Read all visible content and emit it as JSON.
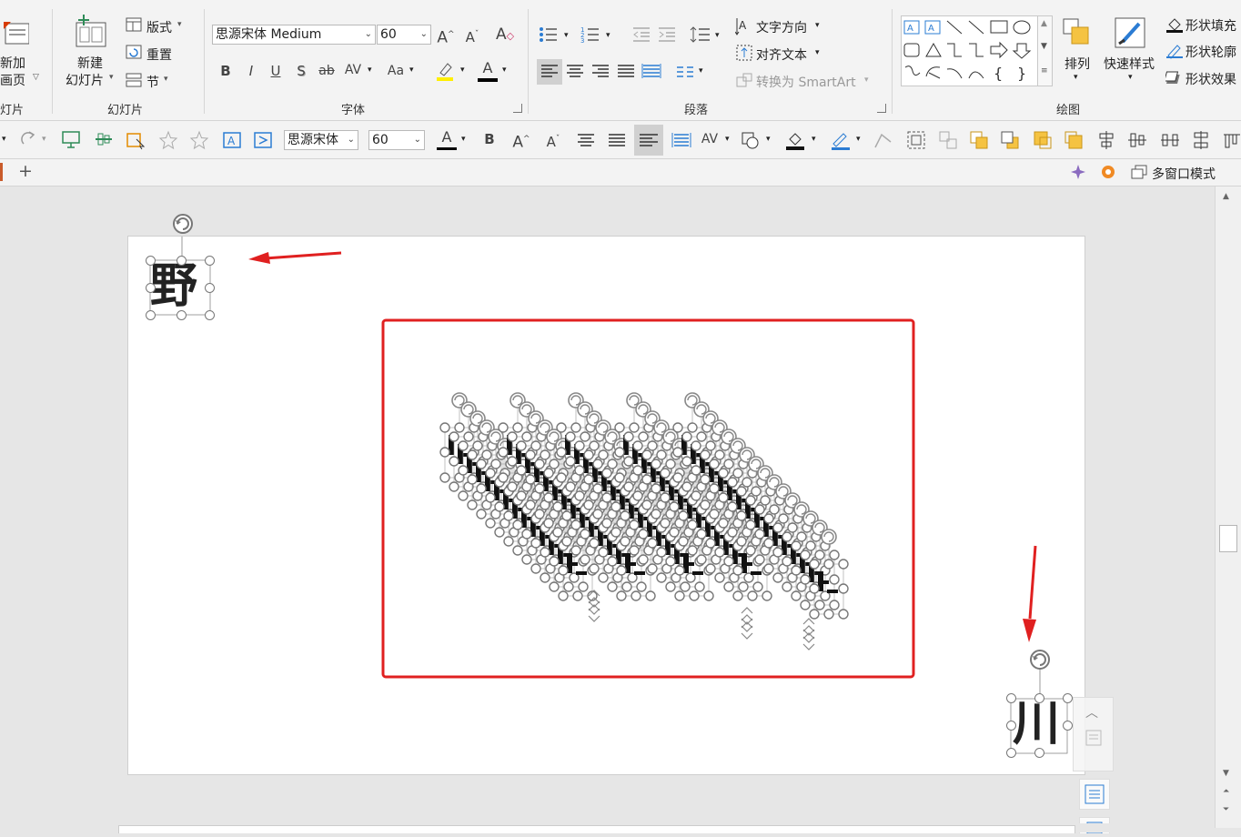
{
  "ribbon": {
    "new_slide_partial_line1": "新加",
    "new_slide_partial_line2": "画页",
    "group_partial_label": "灯片",
    "new_slide_line1": "新建",
    "new_slide_line2": "幻灯片",
    "layout_label": "版式",
    "reset_label": "重置",
    "section_label": "节",
    "slides_group_label": "幻灯片",
    "font_name": "思源宋体 Medium",
    "font_size": "60",
    "bold": "B",
    "italic": "I",
    "underline": "U",
    "shadow": "S",
    "strike": "ab",
    "spacing": "AV",
    "case": "Aa",
    "font_color": "A",
    "font_group_label": "字体",
    "text_direction_label": "文字方向",
    "align_text_label": "对齐文本",
    "smartart_label": "转换为 SmartArt",
    "paragraph_group_label": "段落",
    "arrange_label": "排列",
    "quick_styles_label": "快速样式",
    "shape_fill_label": "形状填充",
    "shape_outline_label": "形状轮廓",
    "shape_effects_label": "形状效果",
    "drawing_group_label": "绘图"
  },
  "quickbar": {
    "font_name": "思源宋体",
    "font_size": "60",
    "bold": "B"
  },
  "tabbar": {
    "add_tab": "+",
    "multi_window_label": "多窗口模式"
  },
  "slide": {
    "top_left_char": "野",
    "bottom_right_char": "川"
  },
  "colors": {
    "annotation_red": "#e02020",
    "accent": "#2b7cd3"
  }
}
